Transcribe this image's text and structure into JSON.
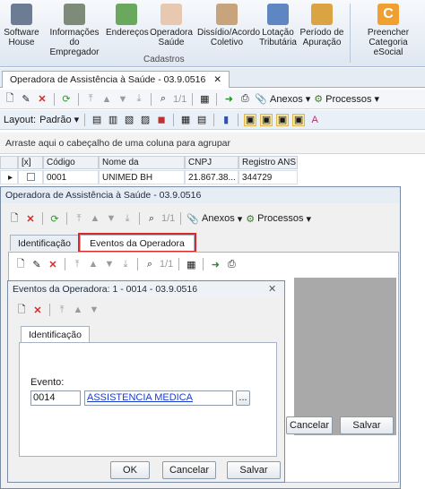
{
  "ribbon": {
    "buttons": [
      {
        "label": "Software\nHouse",
        "icon": "building-icon"
      },
      {
        "label": "Informações\ndo Empregador",
        "icon": "calculator-icon"
      },
      {
        "label": "Endereços",
        "icon": "map-icon"
      },
      {
        "label": "Operadora\nSaúde",
        "icon": "nurse-icon"
      },
      {
        "label": "Dissídio/Acordo\nColetivo",
        "icon": "handshake-icon"
      },
      {
        "label": "Lotação\nTributária",
        "icon": "people-icon"
      },
      {
        "label": "Período de\nApuração",
        "icon": "calendar-icon"
      },
      {
        "label": "Preencher\nCategoria eSocial",
        "icon": "c-icon"
      }
    ],
    "group_label": "Cadastros"
  },
  "document_tab": {
    "title": "Operadora de Assistência à Saúde - 03.9.0516"
  },
  "main_toolbar": {
    "page": "1/1",
    "anexos": "Anexos",
    "processos": "Processos"
  },
  "layout_bar": {
    "label": "Layout:",
    "value": "Padrão"
  },
  "group_hint": "Arraste aqui o cabeçalho de uma coluna para agrupar",
  "grid": {
    "headers": [
      "[x]",
      "Código",
      "Nome da Operadora",
      "CNPJ",
      "Registro ANS"
    ],
    "row": {
      "code": "0001",
      "name": "UNIMED BH",
      "cnpj": "21.867.38...",
      "ans": "344729"
    }
  },
  "dialog1": {
    "title": "Operadora de Assistência à Saúde - 03.9.0516",
    "page": "1/1",
    "anexos": "Anexos",
    "processos": "Processos",
    "tabs": [
      "Identificação",
      "Eventos da Operadora"
    ],
    "inner_page": "1/1",
    "cancel": "Cancelar",
    "save": "Salvar"
  },
  "dialog2": {
    "title": "Eventos da Operadora: 1 - 0014 - 03.9.0516",
    "close": "✕",
    "tab": "Identificação",
    "evento_label": "Evento:",
    "evento_code": "0014",
    "evento_name": "ASSISTENCIA MEDICA",
    "browse": "...",
    "ok": "OK",
    "cancel": "Cancelar",
    "save": "Salvar"
  },
  "colors": {
    "highlight_red": "#d42a2a",
    "link_blue": "#1a3ccc"
  }
}
